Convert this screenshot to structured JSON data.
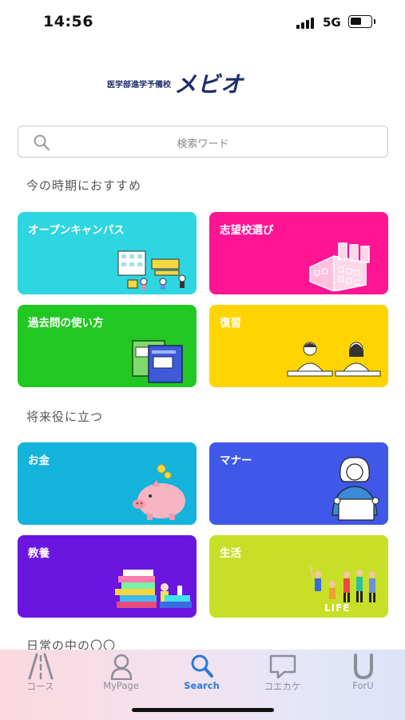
{
  "status_bar": {
    "time": "14:56",
    "network": "5G",
    "battery_level": 0.55
  },
  "logo": {
    "sub": "医学部進学予備校",
    "main": "メビオ"
  },
  "search": {
    "placeholder": "検索ワード"
  },
  "sections": [
    {
      "title": "今の時期におすすめ"
    },
    {
      "title": "将来役に立つ"
    },
    {
      "title": "日常の中の〇〇"
    }
  ],
  "cards": [
    {
      "label": "オープンキャンパス",
      "color": "#2dd6e0",
      "icon": "open-campus-illustration"
    },
    {
      "label": "志望校選び",
      "color": "#ff1493",
      "icon": "school-building-illustration"
    },
    {
      "label": "過去問の使い方",
      "color": "#22c822",
      "icon": "books-illustration"
    },
    {
      "label": "復習",
      "color": "#ffd400",
      "icon": "students-studying-illustration"
    },
    {
      "label": "お金",
      "color": "#13b3dc",
      "icon": "piggy-bank-illustration"
    },
    {
      "label": "マナー",
      "color": "#3f58e8",
      "icon": "woman-with-paper-illustration"
    },
    {
      "label": "教養",
      "color": "#6a16e0",
      "icon": "stacked-books-illustration"
    },
    {
      "label": "生活",
      "color": "#c8df28",
      "icon": "life-people-illustration",
      "art_text": "LIFE"
    }
  ],
  "tabs": [
    {
      "label": "コース",
      "icon": "road-icon",
      "active": false
    },
    {
      "label": "MyPage",
      "icon": "person-icon",
      "active": false
    },
    {
      "label": "Search",
      "icon": "search-icon",
      "active": true
    },
    {
      "label": "コエカケ",
      "icon": "chat-bubble-icon",
      "active": false
    },
    {
      "label": "ForU",
      "icon": "foru-icon",
      "active": false
    }
  ]
}
